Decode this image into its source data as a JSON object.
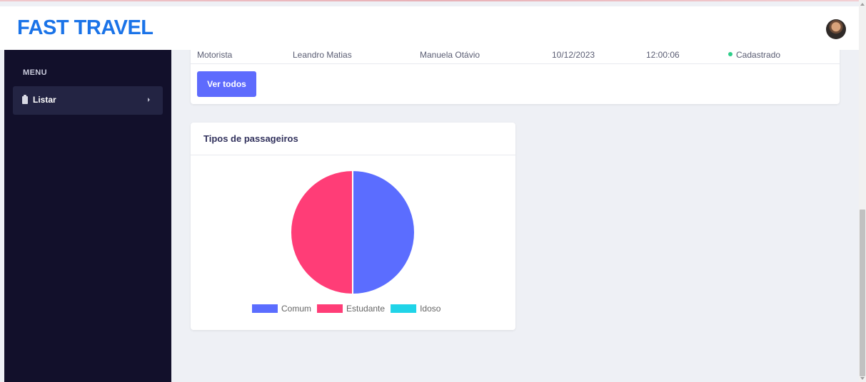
{
  "header": {
    "brand": "FAST TRAVEL",
    "avatar_icon": "user-avatar"
  },
  "sidebar": {
    "menu_title": "MENU",
    "items": [
      {
        "label": "Listar",
        "icon": "clipboard-icon"
      }
    ]
  },
  "table": {
    "rows": [
      {
        "cells": [
          "Motorista",
          "Leandro Matias",
          "Manuela Otávio",
          "10/12/2023",
          "12:00:06",
          "Cadastrado"
        ],
        "status_color": "#2dce89"
      }
    ]
  },
  "buttons": {
    "ver_todos": "Ver todos"
  },
  "chart_card": {
    "title": "Tipos de passageiros"
  },
  "chart_data": {
    "type": "pie",
    "title": "Tipos de passageiros",
    "categories": [
      "Comum",
      "Estudante",
      "Idoso"
    ],
    "values": [
      50,
      50,
      0
    ],
    "colors": [
      "#5b6dff",
      "#ff3d77",
      "#20d4e8"
    ],
    "legend_position": "bottom"
  },
  "colors": {
    "brand": "#1a73e8",
    "sidebar_bg": "#12102b",
    "button_primary": "#5e6bfd"
  }
}
